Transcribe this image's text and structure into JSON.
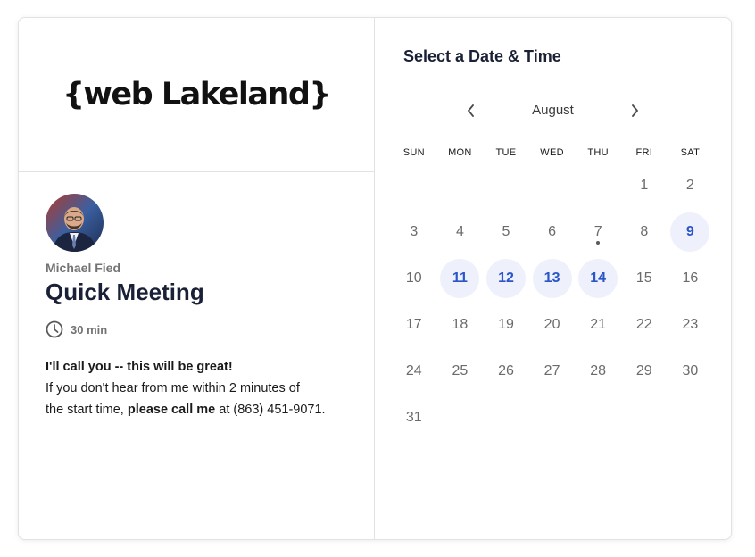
{
  "brand": {
    "logo_text": "{web Lakeland}"
  },
  "event": {
    "host_name": "Michael Fied",
    "title": "Quick Meeting",
    "duration": "30 min",
    "description_bold": "I'll call you -- this will be great!",
    "description_line1": "If you don't hear from me within 2 minutes of",
    "description_line2_start": "the start time,",
    "description_line2_bold": "please call me",
    "description_line2_end": "at (863) 451-9071."
  },
  "calendar": {
    "section_title": "Select a Date & Time",
    "month": "August",
    "weekdays": [
      "SUN",
      "MON",
      "TUE",
      "WED",
      "THU",
      "FRI",
      "SAT"
    ],
    "first_weekday_index": 5,
    "days_in_month": 31,
    "available_days": [
      9,
      11,
      12,
      13,
      14
    ],
    "today": 7,
    "accent_color": "#2b56c8",
    "available_bg": "#eef1fb"
  },
  "icons": {
    "prev": "chevron-left-icon",
    "next": "chevron-right-icon",
    "clock": "clock-icon"
  }
}
